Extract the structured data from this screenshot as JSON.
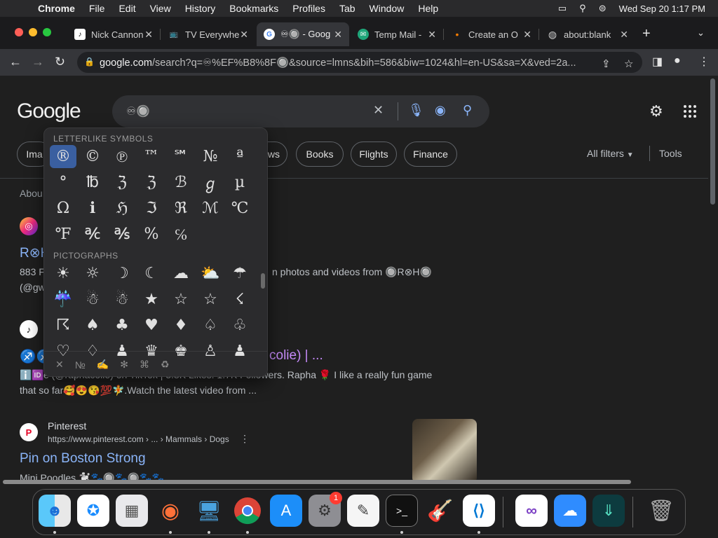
{
  "menubar": {
    "app": "Chrome",
    "items": [
      "File",
      "Edit",
      "View",
      "History",
      "Bookmarks",
      "Profiles",
      "Tab",
      "Window",
      "Help"
    ],
    "datetime": "Wed Sep 20  1:17 PM"
  },
  "tabs": [
    {
      "title": "Nick Cannon",
      "favicon": "tiktok-icon"
    },
    {
      "title": "TV Everywhe",
      "favicon": "tv-icon"
    },
    {
      "title": "♾🔘 - Goog",
      "favicon": "google-icon"
    },
    {
      "title": "Temp Mail -",
      "favicon": "tempmail-icon"
    },
    {
      "title": "Create an O",
      "favicon": "loading-icon"
    },
    {
      "title": "about:blank",
      "favicon": "globe-icon"
    }
  ],
  "toolbar": {
    "url_host": "google.com",
    "url_rest": "/search?q=♾%EF%B8%8F🔘&source=lmns&bih=586&biw=1024&hl=en-US&sa=X&ved=2a..."
  },
  "search": {
    "logo": "Google",
    "query": "♾🔘"
  },
  "chips": [
    "Ima",
    "ews",
    "Books",
    "Flights",
    "Finance"
  ],
  "filters_label": "All filters",
  "tools_label": "Tools",
  "about": "Abou",
  "results": [
    {
      "title": "R⊗H",
      "line1_a": "883 F",
      "line1_b": "n photos and videos from 🔘R⊗H🔘",
      "line2": "(@gw"
    },
    {
      "title": "colie) | ...",
      "prefix": "♐♐",
      "line1_a": "ℹ️🆔",
      "line1_b": "e (@raphacolie) on TikTok | 3.8K Likes. 1.7K Followers. Rapha 🌹 I like a really fun game",
      "line2": "that so far🥰😍😘💯🧚.Watch the latest video from ..."
    },
    {
      "site": "Pinterest",
      "url": "https://www.pinterest.com › ... › Mammals › Dogs",
      "title": "Pin on Boston Strong",
      "snippet": "Mini Poodles 🐩🐾🔘🐾🔘🐾🐾"
    }
  ],
  "picker": {
    "section1": "LETTERLIKE SYMBOLS",
    "row1": [
      "®",
      "©",
      "℗",
      "™",
      "℠",
      "№",
      "ª"
    ],
    "row2": [
      "°",
      "℔",
      "ℨ",
      "ℨ",
      "ℬ",
      "ℊ",
      "µ"
    ],
    "row3": [
      "Ω",
      "ℹ",
      "ℌ",
      "ℑ",
      "ℜ",
      "ℳ",
      "℃"
    ],
    "row4": [
      "℉",
      "℀",
      "℁",
      "%",
      "℅"
    ],
    "section2": "PICTOGRAPHS",
    "row5": [
      "☀",
      "☼",
      "☽",
      "☾",
      "☁",
      "⛅",
      "☂"
    ],
    "row6": [
      "☔",
      "☃",
      "☃",
      "★",
      "☆",
      "☆",
      "☇"
    ],
    "row7": [
      "☈",
      "♠",
      "♣",
      "♥",
      "♦",
      "♤",
      "♧"
    ],
    "row8": [
      "♡",
      "♢",
      "♟",
      "♛",
      "♚",
      "♙",
      "♟"
    ],
    "footer": [
      "✕",
      "№",
      "✍",
      "✻",
      "⌘",
      "♻"
    ]
  },
  "dock": {
    "badge_count": "1"
  },
  "colors": {
    "link": "#8ab4f8",
    "visited": "#c58af9",
    "page_bg": "#1f1f1f"
  }
}
